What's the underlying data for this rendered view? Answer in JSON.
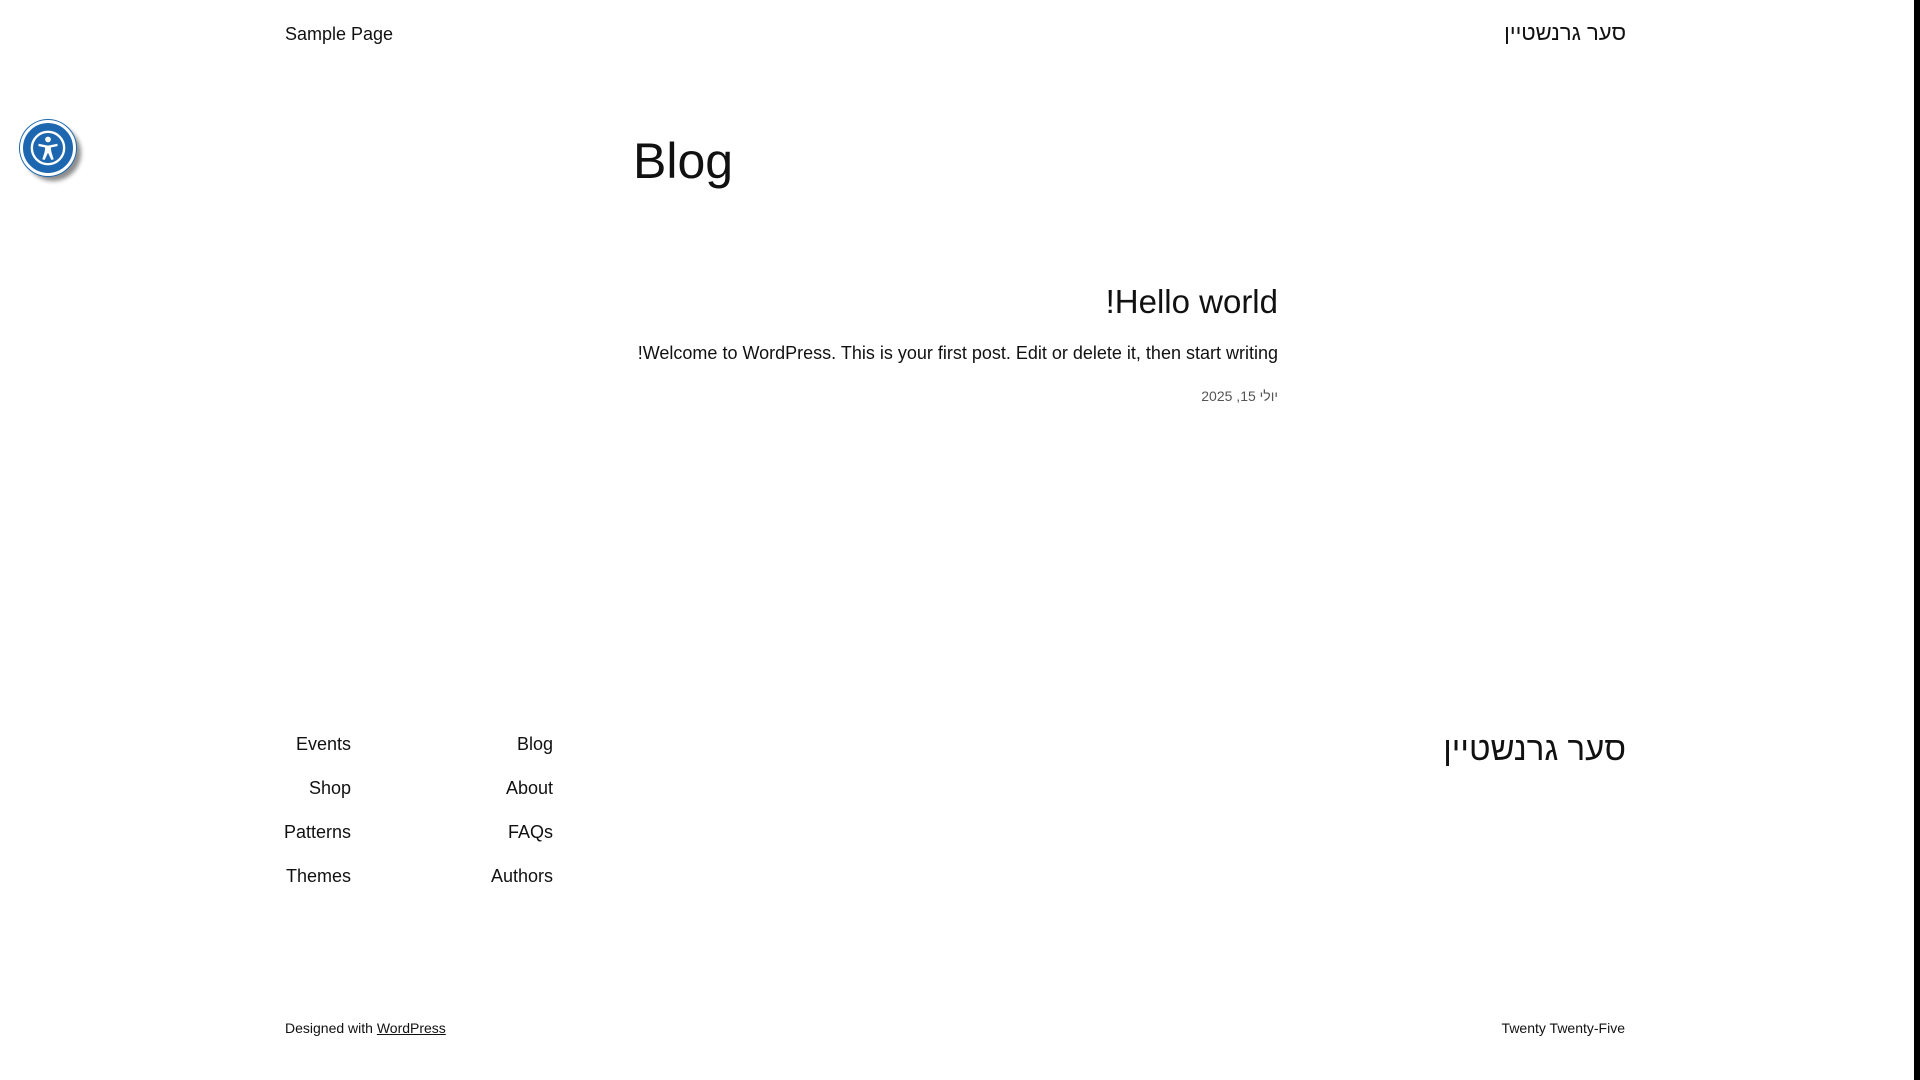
{
  "header": {
    "site_title": "סער גרנשטיין",
    "nav": [
      {
        "label": "Sample Page"
      }
    ]
  },
  "accessibility": {
    "icon": "accessibility-icon",
    "color": "#1c67b0"
  },
  "main": {
    "heading": "Blog",
    "posts": [
      {
        "title": "Hello world!",
        "excerpt": "Welcome to WordPress. This is your first post. Edit or delete it, then start writing!",
        "date": "יולי 15, 2025"
      }
    ]
  },
  "footer": {
    "site_title": "סער גרנשטיין",
    "nav_col_1": [
      {
        "label": "Blog"
      },
      {
        "label": "About"
      },
      {
        "label": "FAQs"
      },
      {
        "label": "Authors"
      }
    ],
    "nav_col_2": [
      {
        "label": "Events"
      },
      {
        "label": "Shop"
      },
      {
        "label": "Patterns"
      },
      {
        "label": "Themes"
      }
    ],
    "credit_prefix": "Designed with",
    "credit_link": "WordPress",
    "theme_name": "Twenty Twenty-Five"
  }
}
